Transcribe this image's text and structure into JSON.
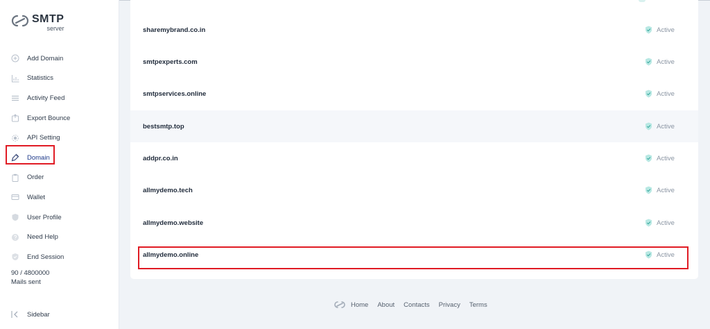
{
  "brand": {
    "name": "SMTP",
    "sub": "server"
  },
  "nav": [
    {
      "label": "Add Domain",
      "icon": "plus-circle-icon"
    },
    {
      "label": "Statistics",
      "icon": "chart-axis-icon"
    },
    {
      "label": "Activity Feed",
      "icon": "list-lines-icon"
    },
    {
      "label": "Export Bounce",
      "icon": "export-icon"
    },
    {
      "label": "API Setting",
      "icon": "gear-icon"
    },
    {
      "label": "Domain",
      "icon": "tag-icon",
      "active": true
    },
    {
      "label": "Order",
      "icon": "clipboard-icon"
    },
    {
      "label": "Wallet",
      "icon": "wallet-icon"
    },
    {
      "label": "User Profile",
      "icon": "shield-user-icon"
    },
    {
      "label": "Need Help",
      "icon": "help-circle-icon"
    },
    {
      "label": "End Session",
      "icon": "check-shield-icon"
    }
  ],
  "usage": {
    "count": "90 / 4800000",
    "caption": "Mails sent"
  },
  "sidebar_toggle": {
    "label": "Sidebar"
  },
  "domains": [
    {
      "name": "sharemybrand.co.in",
      "status": "Active"
    },
    {
      "name": "smtpexperts.com",
      "status": "Active"
    },
    {
      "name": "smtpservices.online",
      "status": "Active"
    },
    {
      "name": "bestsmtp.top",
      "status": "Active"
    },
    {
      "name": "addpr.co.in",
      "status": "Active"
    },
    {
      "name": "allmydemo.tech",
      "status": "Active"
    },
    {
      "name": "allmydemo.website",
      "status": "Active"
    },
    {
      "name": "allmydemo.online",
      "status": "Active"
    }
  ],
  "footer": {
    "links": [
      "Home",
      "About",
      "Contacts",
      "Privacy",
      "Terms"
    ]
  },
  "colors": {
    "accent": "#1e3a8a",
    "badge": "#5fc8bf",
    "highlight": "#e01b24",
    "page_bg": "#f0f3f7"
  }
}
